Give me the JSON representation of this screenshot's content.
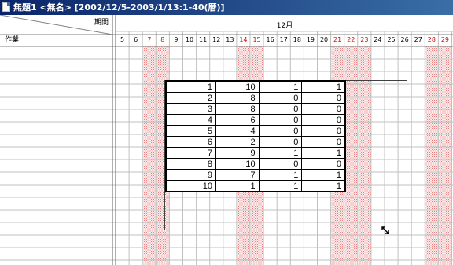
{
  "window": {
    "title": "無題1 <無名> [2002/12/5-2003/1/13:1-40(暦)]"
  },
  "header": {
    "period_label": "期間",
    "task_label": "作業",
    "month_label": "12月"
  },
  "days": [
    {
      "label": "5",
      "holiday": false
    },
    {
      "label": "6",
      "holiday": false
    },
    {
      "label": "7",
      "holiday": true
    },
    {
      "label": "8",
      "holiday": true
    },
    {
      "label": "9",
      "holiday": false
    },
    {
      "label": "10",
      "holiday": false
    },
    {
      "label": "11",
      "holiday": false
    },
    {
      "label": "12",
      "holiday": false
    },
    {
      "label": "13",
      "holiday": false
    },
    {
      "label": "14",
      "holiday": true
    },
    {
      "label": "15",
      "holiday": true
    },
    {
      "label": "16",
      "holiday": false
    },
    {
      "label": "17",
      "holiday": false
    },
    {
      "label": "18",
      "holiday": false
    },
    {
      "label": "19",
      "holiday": false
    },
    {
      "label": "20",
      "holiday": false
    },
    {
      "label": "21",
      "holiday": true
    },
    {
      "label": "22",
      "holiday": true
    },
    {
      "label": "23",
      "holiday": true
    },
    {
      "label": "24",
      "holiday": false
    },
    {
      "label": "25",
      "holiday": false
    },
    {
      "label": "26",
      "holiday": false
    },
    {
      "label": "27",
      "holiday": false
    },
    {
      "label": "28",
      "holiday": true
    },
    {
      "label": "29",
      "holiday": true
    }
  ],
  "colors": {
    "holiday_text": "#e00000",
    "holiday_fill": "#f6c8c8",
    "grid_line": "#c0c0c0"
  },
  "popup_table": {
    "rows": [
      [
        "1",
        "10",
        "1",
        "1"
      ],
      [
        "2",
        "8",
        "0",
        "0"
      ],
      [
        "3",
        "8",
        "0",
        "0"
      ],
      [
        "4",
        "6",
        "0",
        "0"
      ],
      [
        "5",
        "4",
        "0",
        "0"
      ],
      [
        "6",
        "2",
        "0",
        "0"
      ],
      [
        "7",
        "9",
        "1",
        "1"
      ],
      [
        "8",
        "10",
        "0",
        "0"
      ],
      [
        "9",
        "7",
        "1",
        "1"
      ],
      [
        "10",
        "1",
        "1",
        "1"
      ]
    ]
  },
  "icons": {
    "app": "document-icon",
    "resize": "resize-handle-icon"
  }
}
